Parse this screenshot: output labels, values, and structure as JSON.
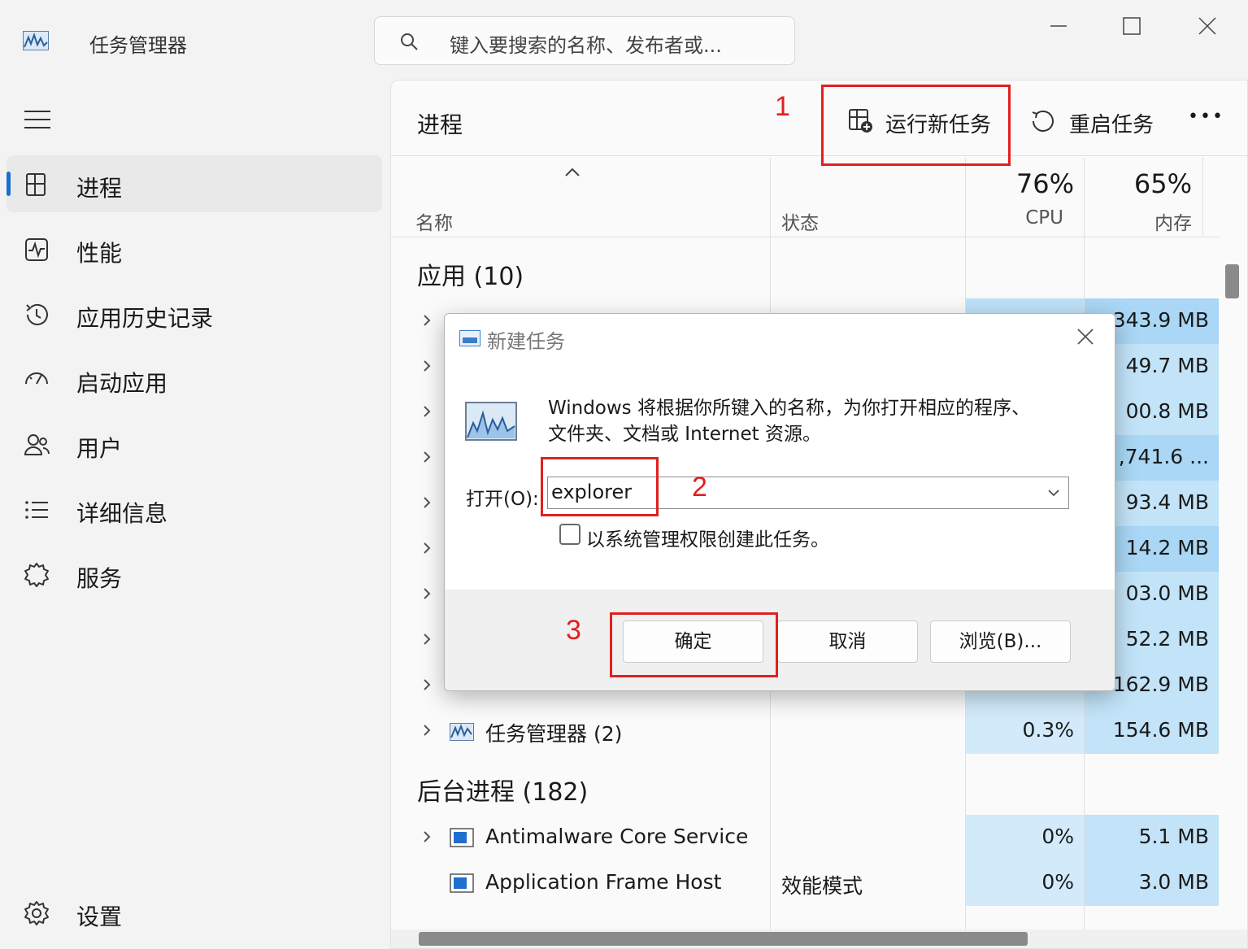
{
  "titlebar": {
    "app_title": "任务管理器",
    "search_placeholder": "键入要搜索的名称、发布者或..."
  },
  "sidebar": {
    "items": [
      {
        "label": "进程",
        "icon": "processes-icon",
        "active": true
      },
      {
        "label": "性能",
        "icon": "performance-icon"
      },
      {
        "label": "应用历史记录",
        "icon": "app-history-icon"
      },
      {
        "label": "启动应用",
        "icon": "startup-apps-icon"
      },
      {
        "label": "用户",
        "icon": "users-icon"
      },
      {
        "label": "详细信息",
        "icon": "details-icon"
      },
      {
        "label": "服务",
        "icon": "services-icon"
      }
    ],
    "settings_label": "设置"
  },
  "main": {
    "page_title": "进程",
    "run_new_task_label": "运行新任务",
    "restart_task_label": "重启任务",
    "more_label": "•••",
    "columns": {
      "name": "名称",
      "status": "状态",
      "cpu_pct": "76%",
      "cpu_label": "CPU",
      "mem_pct": "65%",
      "mem_label": "内存"
    },
    "apps_group": "应用 (10)",
    "app_rows_visible_mem": [
      "343.9 MB",
      "49.7 MB",
      "00.8 MB",
      ",741.6 ...",
      "93.4 MB",
      "14.2 MB",
      "03.0 MB",
      "52.2 MB",
      "162.9 MB"
    ],
    "task_manager_row": {
      "name": "任务管理器 (2)",
      "cpu": "0.3%",
      "mem": "154.6 MB"
    },
    "background_group": "后台进程 (182)",
    "background_rows": [
      {
        "name": "Antimalware Core Service",
        "status": "",
        "cpu": "0%",
        "mem": "5.1 MB"
      },
      {
        "name": "Application Frame Host",
        "status": "效能模式",
        "cpu": "0%",
        "mem": "3.0 MB"
      }
    ]
  },
  "dialog": {
    "title": "新建任务",
    "description_line1": "Windows 将根据你所键入的名称，为你打开相应的程序、",
    "description_line2": "文件夹、文档或 Internet 资源。",
    "open_label": "打开(O):",
    "open_value": "explorer",
    "admin_checkbox_label": "以系统管理权限创建此任务。",
    "admin_checked": false,
    "ok_label": "确定",
    "cancel_label": "取消",
    "browse_label": "浏览(B)..."
  },
  "annotations": {
    "step1": "1",
    "step2": "2",
    "step3": "3",
    "color": "#e02020"
  },
  "colors": {
    "accent": "#1a6fd1",
    "cpu_cell": "#d2eafa",
    "mem_cell": "#c2e3f8"
  }
}
